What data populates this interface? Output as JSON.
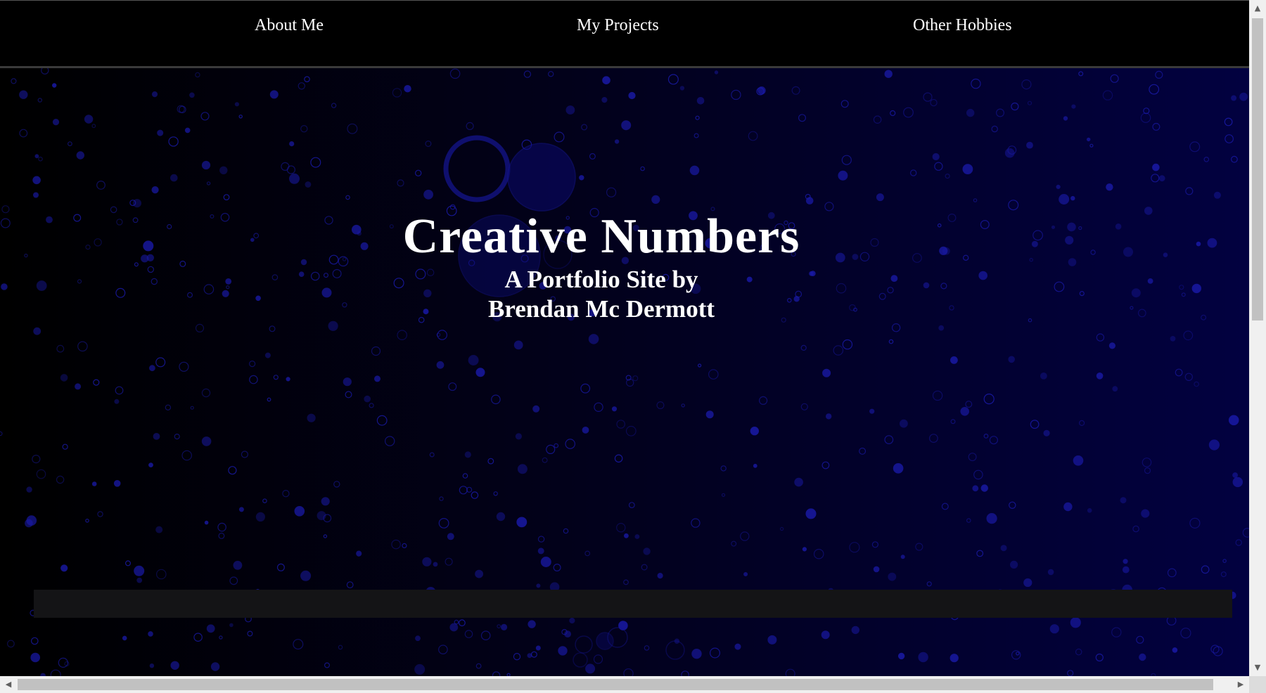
{
  "nav": {
    "items": [
      {
        "label": "About Me"
      },
      {
        "label": "My Projects"
      },
      {
        "label": "Other Hobbies"
      }
    ]
  },
  "hero": {
    "title": "Creative Numbers",
    "subtitle_line1": "A Portfolio Site by",
    "subtitle_line2": "Brendan Mc Dermott"
  },
  "colors": {
    "background": "#000000",
    "gradient_end": "#020140",
    "bubble": "#1a1aa8",
    "text": "#ffffff",
    "nav_border": "#3a3a3a"
  },
  "icons": {
    "scroll_up": "▲",
    "scroll_down": "▼",
    "scroll_left": "◀",
    "scroll_right": "▶"
  }
}
